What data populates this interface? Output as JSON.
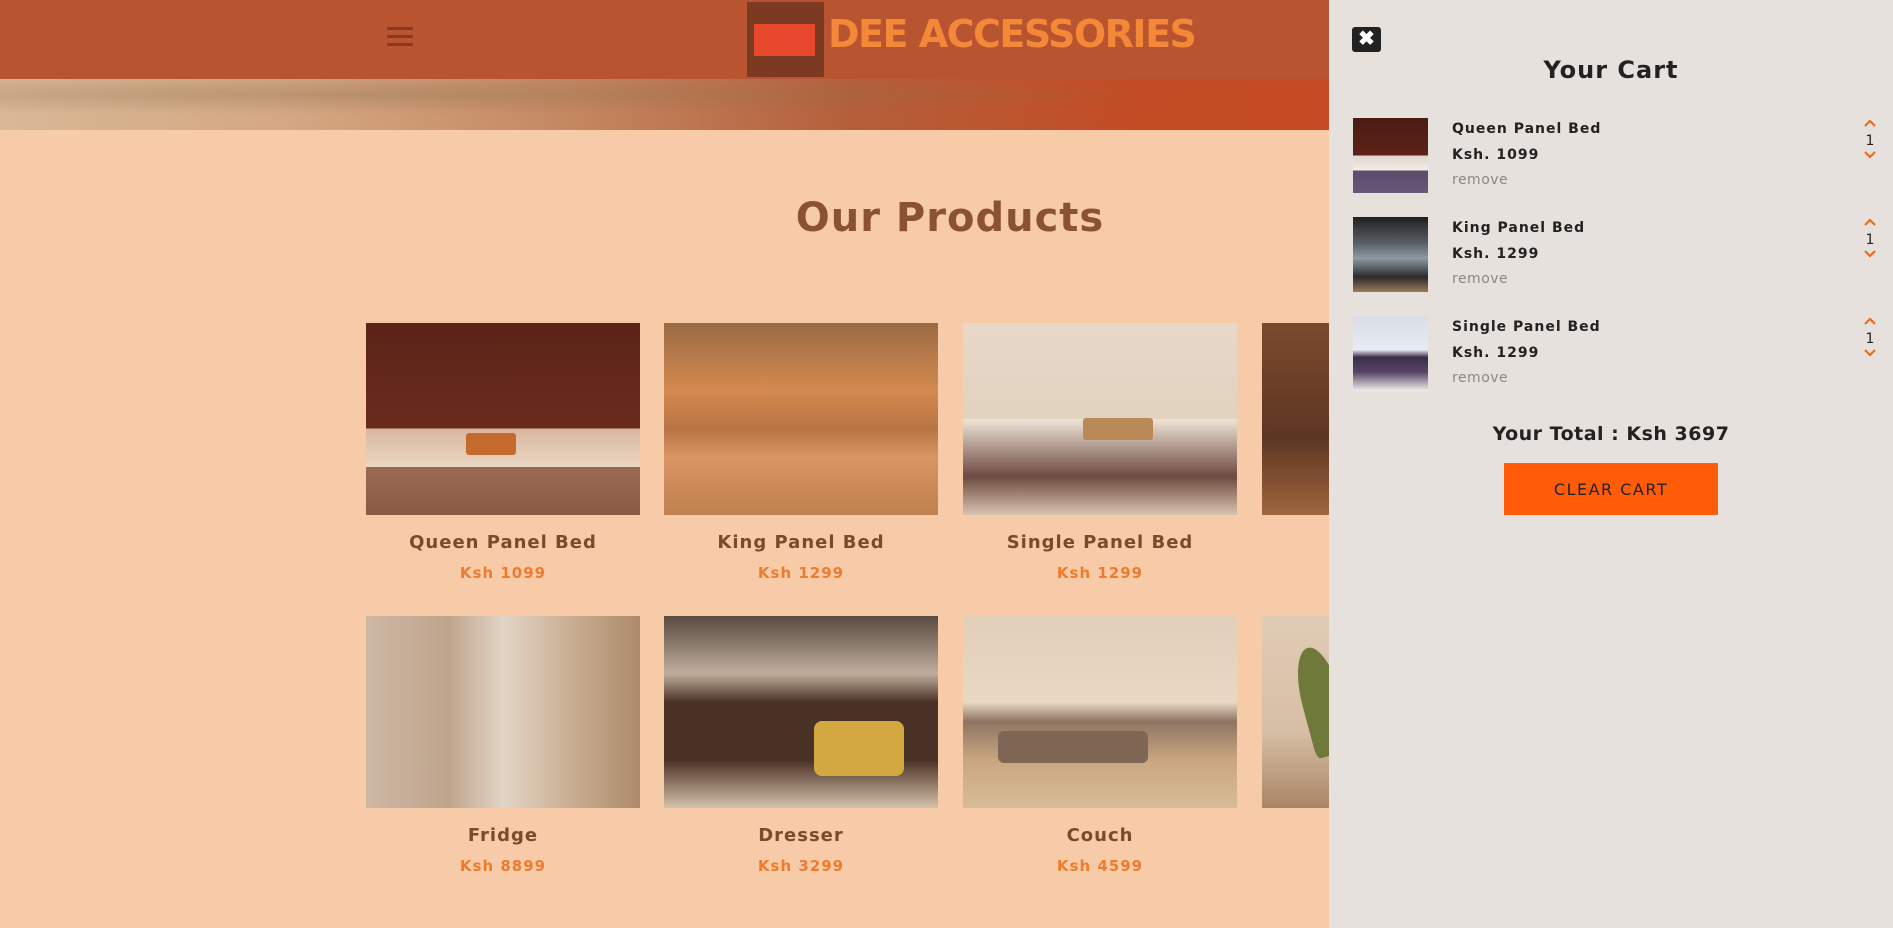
{
  "header": {
    "brand": "DEE ACCESSORIES",
    "menu_icon": "hamburger-menu-icon"
  },
  "main": {
    "section_title": "Our Products",
    "products": [
      {
        "name": "Queen Panel Bed",
        "price": "Ksh 1099"
      },
      {
        "name": "King Panel Bed",
        "price": "Ksh 1299"
      },
      {
        "name": "Single Panel Bed",
        "price": "Ksh 1299"
      },
      {
        "name": "",
        "price": ""
      },
      {
        "name": "Fridge",
        "price": "Ksh 8899"
      },
      {
        "name": "Dresser",
        "price": "Ksh 3299"
      },
      {
        "name": "Couch",
        "price": "Ksh 4599"
      },
      {
        "name": "",
        "price": ""
      }
    ]
  },
  "cart": {
    "close_icon": "close-icon",
    "title": "Your Cart",
    "items": [
      {
        "name": "Queen Panel Bed",
        "price": "Ksh. 1099",
        "remove_label": "remove",
        "quantity": "1"
      },
      {
        "name": "King Panel Bed",
        "price": "Ksh. 1299",
        "remove_label": "remove",
        "quantity": "1"
      },
      {
        "name": "Single Panel Bed",
        "price": "Ksh. 1299",
        "remove_label": "remove",
        "quantity": "1"
      }
    ],
    "total": "Your Total : Ksh 3697",
    "clear_label": "CLEAR CART"
  },
  "colors": {
    "navbar": "#b85430",
    "page_background": "#f7cba7",
    "accent": "#ff5c0a",
    "cart_background": "#e7e1de"
  }
}
